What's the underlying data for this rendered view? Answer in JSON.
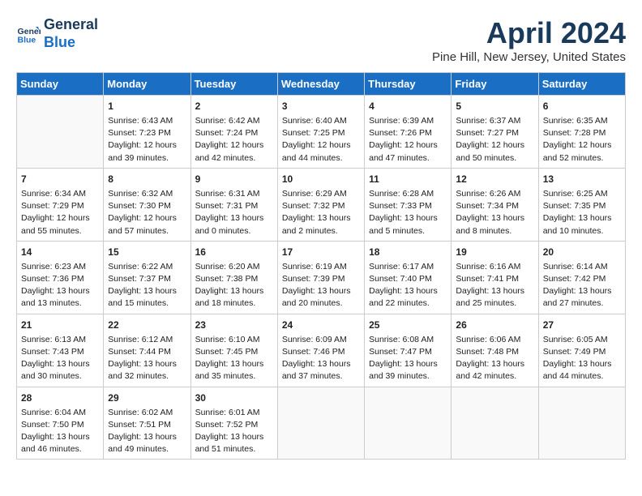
{
  "header": {
    "logo_line1": "General",
    "logo_line2": "Blue",
    "month_title": "April 2024",
    "location": "Pine Hill, New Jersey, United States"
  },
  "weekdays": [
    "Sunday",
    "Monday",
    "Tuesday",
    "Wednesday",
    "Thursday",
    "Friday",
    "Saturday"
  ],
  "weeks": [
    [
      {
        "day": "",
        "content": ""
      },
      {
        "day": "1",
        "sunrise": "Sunrise: 6:43 AM",
        "sunset": "Sunset: 7:23 PM",
        "daylight": "Daylight: 12 hours and 39 minutes."
      },
      {
        "day": "2",
        "sunrise": "Sunrise: 6:42 AM",
        "sunset": "Sunset: 7:24 PM",
        "daylight": "Daylight: 12 hours and 42 minutes."
      },
      {
        "day": "3",
        "sunrise": "Sunrise: 6:40 AM",
        "sunset": "Sunset: 7:25 PM",
        "daylight": "Daylight: 12 hours and 44 minutes."
      },
      {
        "day": "4",
        "sunrise": "Sunrise: 6:39 AM",
        "sunset": "Sunset: 7:26 PM",
        "daylight": "Daylight: 12 hours and 47 minutes."
      },
      {
        "day": "5",
        "sunrise": "Sunrise: 6:37 AM",
        "sunset": "Sunset: 7:27 PM",
        "daylight": "Daylight: 12 hours and 50 minutes."
      },
      {
        "day": "6",
        "sunrise": "Sunrise: 6:35 AM",
        "sunset": "Sunset: 7:28 PM",
        "daylight": "Daylight: 12 hours and 52 minutes."
      }
    ],
    [
      {
        "day": "7",
        "sunrise": "Sunrise: 6:34 AM",
        "sunset": "Sunset: 7:29 PM",
        "daylight": "Daylight: 12 hours and 55 minutes."
      },
      {
        "day": "8",
        "sunrise": "Sunrise: 6:32 AM",
        "sunset": "Sunset: 7:30 PM",
        "daylight": "Daylight: 12 hours and 57 minutes."
      },
      {
        "day": "9",
        "sunrise": "Sunrise: 6:31 AM",
        "sunset": "Sunset: 7:31 PM",
        "daylight": "Daylight: 13 hours and 0 minutes."
      },
      {
        "day": "10",
        "sunrise": "Sunrise: 6:29 AM",
        "sunset": "Sunset: 7:32 PM",
        "daylight": "Daylight: 13 hours and 2 minutes."
      },
      {
        "day": "11",
        "sunrise": "Sunrise: 6:28 AM",
        "sunset": "Sunset: 7:33 PM",
        "daylight": "Daylight: 13 hours and 5 minutes."
      },
      {
        "day": "12",
        "sunrise": "Sunrise: 6:26 AM",
        "sunset": "Sunset: 7:34 PM",
        "daylight": "Daylight: 13 hours and 8 minutes."
      },
      {
        "day": "13",
        "sunrise": "Sunrise: 6:25 AM",
        "sunset": "Sunset: 7:35 PM",
        "daylight": "Daylight: 13 hours and 10 minutes."
      }
    ],
    [
      {
        "day": "14",
        "sunrise": "Sunrise: 6:23 AM",
        "sunset": "Sunset: 7:36 PM",
        "daylight": "Daylight: 13 hours and 13 minutes."
      },
      {
        "day": "15",
        "sunrise": "Sunrise: 6:22 AM",
        "sunset": "Sunset: 7:37 PM",
        "daylight": "Daylight: 13 hours and 15 minutes."
      },
      {
        "day": "16",
        "sunrise": "Sunrise: 6:20 AM",
        "sunset": "Sunset: 7:38 PM",
        "daylight": "Daylight: 13 hours and 18 minutes."
      },
      {
        "day": "17",
        "sunrise": "Sunrise: 6:19 AM",
        "sunset": "Sunset: 7:39 PM",
        "daylight": "Daylight: 13 hours and 20 minutes."
      },
      {
        "day": "18",
        "sunrise": "Sunrise: 6:17 AM",
        "sunset": "Sunset: 7:40 PM",
        "daylight": "Daylight: 13 hours and 22 minutes."
      },
      {
        "day": "19",
        "sunrise": "Sunrise: 6:16 AM",
        "sunset": "Sunset: 7:41 PM",
        "daylight": "Daylight: 13 hours and 25 minutes."
      },
      {
        "day": "20",
        "sunrise": "Sunrise: 6:14 AM",
        "sunset": "Sunset: 7:42 PM",
        "daylight": "Daylight: 13 hours and 27 minutes."
      }
    ],
    [
      {
        "day": "21",
        "sunrise": "Sunrise: 6:13 AM",
        "sunset": "Sunset: 7:43 PM",
        "daylight": "Daylight: 13 hours and 30 minutes."
      },
      {
        "day": "22",
        "sunrise": "Sunrise: 6:12 AM",
        "sunset": "Sunset: 7:44 PM",
        "daylight": "Daylight: 13 hours and 32 minutes."
      },
      {
        "day": "23",
        "sunrise": "Sunrise: 6:10 AM",
        "sunset": "Sunset: 7:45 PM",
        "daylight": "Daylight: 13 hours and 35 minutes."
      },
      {
        "day": "24",
        "sunrise": "Sunrise: 6:09 AM",
        "sunset": "Sunset: 7:46 PM",
        "daylight": "Daylight: 13 hours and 37 minutes."
      },
      {
        "day": "25",
        "sunrise": "Sunrise: 6:08 AM",
        "sunset": "Sunset: 7:47 PM",
        "daylight": "Daylight: 13 hours and 39 minutes."
      },
      {
        "day": "26",
        "sunrise": "Sunrise: 6:06 AM",
        "sunset": "Sunset: 7:48 PM",
        "daylight": "Daylight: 13 hours and 42 minutes."
      },
      {
        "day": "27",
        "sunrise": "Sunrise: 6:05 AM",
        "sunset": "Sunset: 7:49 PM",
        "daylight": "Daylight: 13 hours and 44 minutes."
      }
    ],
    [
      {
        "day": "28",
        "sunrise": "Sunrise: 6:04 AM",
        "sunset": "Sunset: 7:50 PM",
        "daylight": "Daylight: 13 hours and 46 minutes."
      },
      {
        "day": "29",
        "sunrise": "Sunrise: 6:02 AM",
        "sunset": "Sunset: 7:51 PM",
        "daylight": "Daylight: 13 hours and 49 minutes."
      },
      {
        "day": "30",
        "sunrise": "Sunrise: 6:01 AM",
        "sunset": "Sunset: 7:52 PM",
        "daylight": "Daylight: 13 hours and 51 minutes."
      },
      {
        "day": "",
        "content": ""
      },
      {
        "day": "",
        "content": ""
      },
      {
        "day": "",
        "content": ""
      },
      {
        "day": "",
        "content": ""
      }
    ]
  ]
}
